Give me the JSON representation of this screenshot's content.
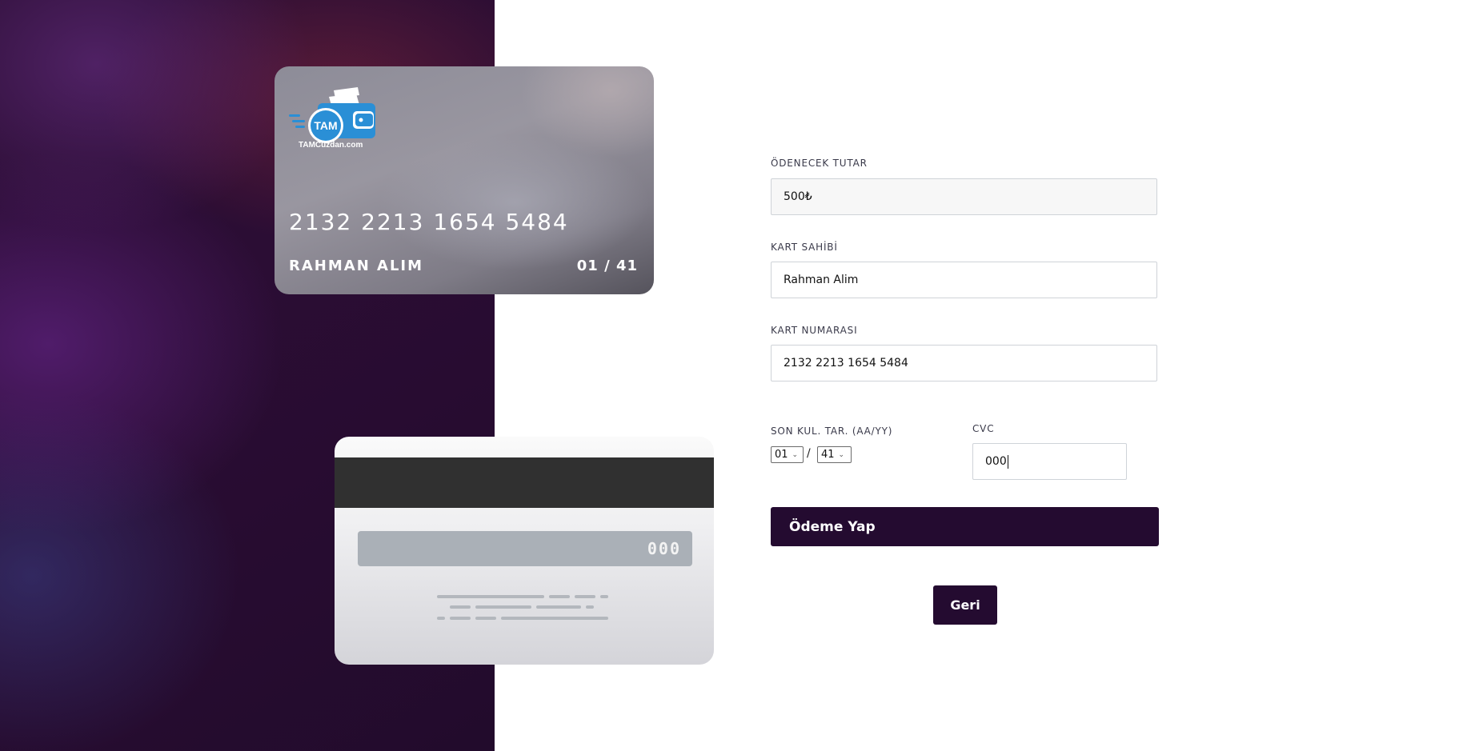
{
  "card_front": {
    "logo_text": "TAM",
    "logo_caption": "TAMCuzdan.com",
    "number": "2132 2213 1654 5484",
    "holder": "RAHMAN ALIM",
    "expiry": "01 / 41"
  },
  "card_back": {
    "cvc": "000"
  },
  "form": {
    "amount_label": "ÖDENECEK TUTAR",
    "amount_value": "500₺",
    "holder_label": "KART SAHİBİ",
    "holder_value": "Rahman Alim",
    "number_label": "KART NUMARASI",
    "number_value": "2132 2213 1654 5484",
    "expiry_label": "SON KUL. TAR. (AA/YY)",
    "expiry_month": "01",
    "expiry_separator": "/",
    "expiry_year": "41",
    "cvc_label": "CVC",
    "cvc_value": "000",
    "pay_button": "Ödeme Yap",
    "back_button": "Geri"
  },
  "colors": {
    "brand_dark": "#240b30",
    "logo_blue": "#2a8fd6"
  }
}
